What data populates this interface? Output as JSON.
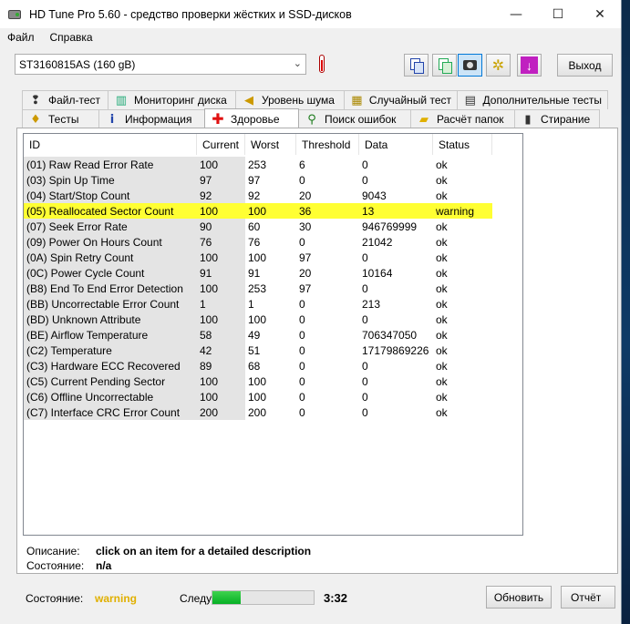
{
  "window": {
    "title": "HD Tune Pro 5.60 - средство проверки жёстких и SSD-дисков"
  },
  "titlebar_controls": {
    "minimize": "—",
    "maximize": "☐",
    "close": "✕"
  },
  "menu": [
    {
      "label": "Файл"
    },
    {
      "label": "Справка"
    }
  ],
  "toolbar": {
    "drive": "ST3160815AS (160 gB)",
    "exit_label": "Выход",
    "icons": [
      "thermometer-icon",
      "copy-text-icon",
      "copy-image-icon",
      "screenshot-icon",
      "options-icon",
      "save-icon"
    ]
  },
  "tabs_top": [
    {
      "label": "Файл-тест",
      "icon": "file-test-icon"
    },
    {
      "label": "Мониторинг диска",
      "icon": "monitor-icon"
    },
    {
      "label": "Уровень шума",
      "icon": "speaker-icon"
    },
    {
      "label": "Случайный тест",
      "icon": "random-icon"
    },
    {
      "label": "Дополнительные тесты",
      "icon": "extra-tests-icon"
    }
  ],
  "tabs_bottom": [
    {
      "label": "Тесты",
      "icon": "benchmark-icon"
    },
    {
      "label": "Информация",
      "icon": "info-icon"
    },
    {
      "label": "Здоровье",
      "icon": "health-icon",
      "active": true
    },
    {
      "label": "Поиск ошибок",
      "icon": "magnifier-icon"
    },
    {
      "label": "Расчёт папок",
      "icon": "folder-icon"
    },
    {
      "label": "Стирание",
      "icon": "erase-icon"
    }
  ],
  "table": {
    "columns": [
      "ID",
      "Current",
      "Worst",
      "Threshold",
      "Data",
      "Status"
    ],
    "rows": [
      [
        "(01) Raw Read Error Rate",
        "100",
        "253",
        "6",
        "0",
        "ok"
      ],
      [
        "(03) Spin Up Time",
        "97",
        "97",
        "0",
        "0",
        "ok"
      ],
      [
        "(04) Start/Stop Count",
        "92",
        "92",
        "20",
        "9043",
        "ok"
      ],
      [
        "(05) Reallocated Sector Count",
        "100",
        "100",
        "36",
        "13",
        "warning"
      ],
      [
        "(07) Seek Error Rate",
        "90",
        "60",
        "30",
        "946769999",
        "ok"
      ],
      [
        "(09) Power On Hours Count",
        "76",
        "76",
        "0",
        "21042",
        "ok"
      ],
      [
        "(0A) Spin Retry Count",
        "100",
        "100",
        "97",
        "0",
        "ok"
      ],
      [
        "(0C) Power Cycle Count",
        "91",
        "91",
        "20",
        "10164",
        "ok"
      ],
      [
        "(B8) End To End Error Detection",
        "100",
        "253",
        "97",
        "0",
        "ok"
      ],
      [
        "(BB) Uncorrectable Error Count",
        "1",
        "1",
        "0",
        "213",
        "ok"
      ],
      [
        "(BD) Unknown Attribute",
        "100",
        "100",
        "0",
        "0",
        "ok"
      ],
      [
        "(BE) Airflow Temperature",
        "58",
        "49",
        "0",
        "706347050",
        "ok"
      ],
      [
        "(C2) Temperature",
        "42",
        "51",
        "0",
        "17179869226",
        "ok"
      ],
      [
        "(C3) Hardware ECC Recovered",
        "89",
        "68",
        "0",
        "0",
        "ok"
      ],
      [
        "(C5) Current Pending Sector",
        "100",
        "100",
        "0",
        "0",
        "ok"
      ],
      [
        "(C6) Offline Uncorrectable",
        "100",
        "100",
        "0",
        "0",
        "ok"
      ],
      [
        "(C7) Interface CRC Error Count",
        "200",
        "200",
        "0",
        "0",
        "ok"
      ]
    ]
  },
  "description": {
    "descr_label": "Описание:",
    "descr_value": "click on an item for a detailed description",
    "state_label": "Состояние:",
    "state_value": "n/a"
  },
  "statusbar": {
    "label": "Состояние:",
    "value": "warning",
    "next_label": "Следующее",
    "progress_fraction": 0.28,
    "time": "3:32",
    "update_label": "Обновить",
    "report_label": "Отчёт"
  },
  "colors": {
    "warning_row": "#ffff33",
    "warning_text": "#e0b000",
    "progress": "#06b025"
  }
}
